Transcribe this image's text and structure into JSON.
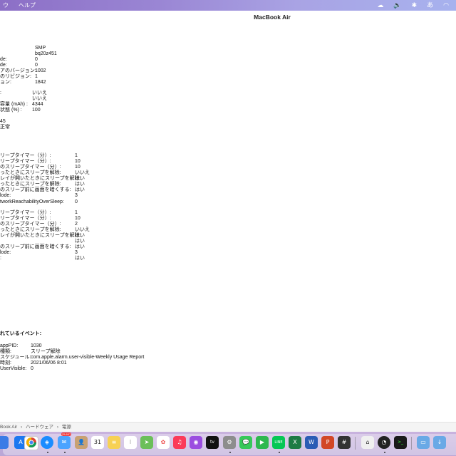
{
  "menubar": {
    "items": [
      "ウ",
      "ヘルプ"
    ],
    "status": {
      "input_method": "あ"
    }
  },
  "window": {
    "title": "MacBook Air"
  },
  "battery_info": {
    "model": [
      {
        "key": "",
        "value": "SMP"
      },
      {
        "key": "",
        "value": "bq20z451"
      },
      {
        "key": "de:",
        "value": "0"
      },
      {
        "key": "de:",
        "value": "0"
      },
      {
        "key": "アのバージョン:",
        "value": "1002"
      },
      {
        "key": "のリビジョン:",
        "value": "1"
      },
      {
        "key": "ョン:",
        "value": "1842"
      }
    ],
    "charge": [
      {
        "key": ":",
        "value": "いいえ"
      },
      {
        "key": "",
        "value": "いいえ"
      },
      {
        "key": "容量 (mAh) :",
        "value": "4344"
      },
      {
        "key": "状態 (%) :",
        "value": "100"
      }
    ],
    "health": [
      {
        "key": "",
        "value": "45"
      },
      {
        "key": "",
        "value": "正常"
      }
    ]
  },
  "power_settings_a": [
    {
      "key": "リープタイマー（分）:",
      "value": "1"
    },
    {
      "key": "リープタイマー（分）:",
      "value": "10"
    },
    {
      "key": "のスリープタイマー（分）:",
      "value": "10"
    },
    {
      "key": "ったときにスリープを解除:",
      "value": "いいえ"
    },
    {
      "key": "レイが開いたときにスリープを解除:",
      "value": "はい"
    },
    {
      "key": "ったときにスリープを解除:",
      "value": "はい"
    },
    {
      "key": "のスリープ前に画面を暗くする:",
      "value": "はい"
    },
    {
      "key": "lode:",
      "value": "3"
    },
    {
      "key": "tworkReachabilityOverSleep:",
      "value": "0"
    }
  ],
  "power_settings_b": [
    {
      "key": "リープタイマー（分）:",
      "value": "1"
    },
    {
      "key": "リープタイマー（分）:",
      "value": "10"
    },
    {
      "key": "のスリープタイマー（分）:",
      "value": "2"
    },
    {
      "key": "ったときにスリープを解除:",
      "value": "いいえ"
    },
    {
      "key": "レイが開いたときにスリープを解除:",
      "value": "はい"
    },
    {
      "key": "",
      "value": "はい"
    },
    {
      "key": "のスリープ前に画面を暗くする:",
      "value": "はい"
    },
    {
      "key": "lode:",
      "value": "3"
    },
    {
      "key": ":",
      "value": "はい"
    }
  ],
  "events": {
    "heading": "れているイベント:",
    "rows": [
      {
        "key": "appPID:",
        "value": "1030"
      },
      {
        "key": "種類:",
        "value": "スリープ解除"
      },
      {
        "key": "スケジュール:",
        "value": "com.apple.alarm.user-visible-Weekly Usage Report"
      },
      {
        "key": "時刻:",
        "value": "2021/06/06 8:01"
      },
      {
        "key": "UserVisible:",
        "value": "0"
      }
    ]
  },
  "pathbar": [
    "Book Air",
    "›",
    "ハードウェア",
    "›",
    "電源"
  ],
  "dock": {
    "calendar_day": "31",
    "mail_badge": "25,607",
    "icons": [
      "chrome-icon",
      "safari-icon",
      "mail-icon",
      "contacts-icon",
      "calendar-icon",
      "notes-icon",
      "reminders-icon",
      "maps-icon",
      "photos-icon",
      "music-icon",
      "podcasts-icon",
      "appletv-icon",
      "system-preferences-icon",
      "messages-icon",
      "facetime-icon",
      "line-icon",
      "excel-icon",
      "word-icon",
      "powerpoint-icon",
      "calculator-icon",
      "home-icon",
      "activity-monitor-icon",
      "terminal-icon",
      "finder-folder-icon",
      "downloads-icon"
    ],
    "colors": {
      "chrome": "#e8e8e8",
      "safari": "#1a8cff",
      "mail": "#4aa3ff",
      "contacts": "#c8a173",
      "calendar": "#ffffff",
      "notes": "#f7d154",
      "reminders": "#ffffff",
      "maps": "#6bbf59",
      "photos": "#ffffff",
      "music": "#fb3b59",
      "podcasts": "#9b4de0",
      "appletv": "#111111",
      "system": "#8d8d8d",
      "messages": "#37c85a",
      "facetime": "#2fb84f",
      "line": "#06c755",
      "excel": "#1e7b45",
      "word": "#2b5cb5",
      "powerpoint": "#d24726",
      "calculator": "#333333",
      "home": "#f0f0f0",
      "activity": "#222222",
      "terminal": "#1a1a1a",
      "folder": "#69a9e6"
    }
  }
}
